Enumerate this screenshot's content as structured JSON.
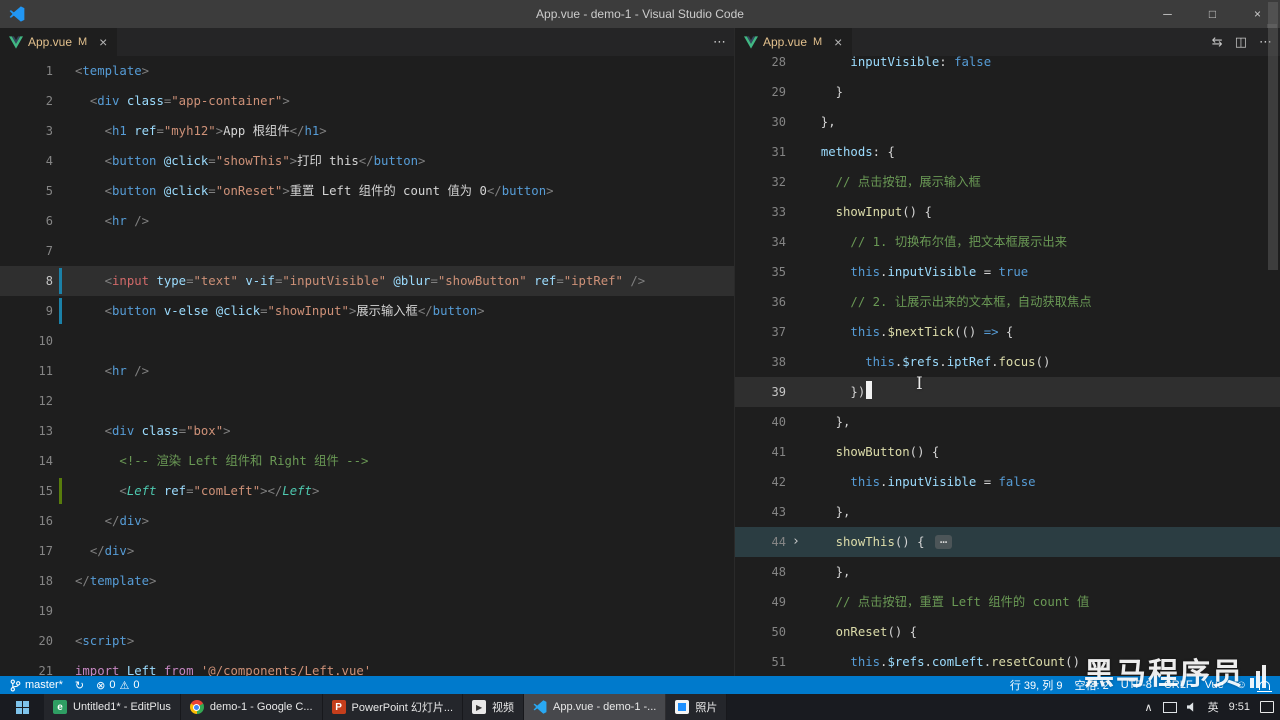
{
  "window": {
    "title": "App.vue - demo-1 - Visual Studio Code"
  },
  "icons": {
    "close": "×",
    "more": "⋯",
    "split": "◫",
    "compare": "⇆",
    "minimize": "─",
    "maximize": "□",
    "chevron_up": "∧",
    "fold_collapsed": "›",
    "sync": "↻",
    "error": "⊗",
    "warning": "⚠",
    "smiley": "☺"
  },
  "colors": {
    "accent": "#007acc",
    "editor_bg": "#1e1e1e",
    "tab_modified_text": "#e2c08d",
    "git_added": "#587c0c",
    "git_modified": "#1b81a8"
  },
  "panes": [
    {
      "tab": {
        "label": "App.vue",
        "badge": "M"
      },
      "actions": [
        "more"
      ],
      "lines": [
        {
          "n": 1,
          "toks": [
            [
              "p",
              "<"
            ],
            [
              "tag",
              "template"
            ],
            [
              "p",
              ">"
            ]
          ]
        },
        {
          "n": 2,
          "toks": [
            [
              "w",
              "  "
            ],
            [
              "p",
              "<"
            ],
            [
              "tag",
              "div"
            ],
            [
              "w",
              " "
            ],
            [
              "attr",
              "class"
            ],
            [
              "p",
              "="
            ],
            [
              "str",
              "\"app-container\""
            ],
            [
              "p",
              ">"
            ]
          ]
        },
        {
          "n": 3,
          "toks": [
            [
              "w",
              "    "
            ],
            [
              "p",
              "<"
            ],
            [
              "tag",
              "h1"
            ],
            [
              "w",
              " "
            ],
            [
              "attr",
              "ref"
            ],
            [
              "p",
              "="
            ],
            [
              "str",
              "\"myh12\""
            ],
            [
              "p",
              ">"
            ],
            [
              "w",
              "App 根组件"
            ],
            [
              "p",
              "</"
            ],
            [
              "tag",
              "h1"
            ],
            [
              "p",
              ">"
            ]
          ]
        },
        {
          "n": 4,
          "toks": [
            [
              "w",
              "    "
            ],
            [
              "p",
              "<"
            ],
            [
              "tag",
              "button"
            ],
            [
              "w",
              " "
            ],
            [
              "attr",
              "@click"
            ],
            [
              "p",
              "="
            ],
            [
              "str",
              "\"showThis\""
            ],
            [
              "p",
              ">"
            ],
            [
              "w",
              "打印 this"
            ],
            [
              "p",
              "</"
            ],
            [
              "tag",
              "button"
            ],
            [
              "p",
              ">"
            ]
          ]
        },
        {
          "n": 5,
          "toks": [
            [
              "w",
              "    "
            ],
            [
              "p",
              "<"
            ],
            [
              "tag",
              "button"
            ],
            [
              "w",
              " "
            ],
            [
              "attr",
              "@click"
            ],
            [
              "p",
              "="
            ],
            [
              "str",
              "\"onReset\""
            ],
            [
              "p",
              ">"
            ],
            [
              "w",
              "重置 Left 组件的 count 值为 0"
            ],
            [
              "p",
              "</"
            ],
            [
              "tag",
              "button"
            ],
            [
              "p",
              ">"
            ]
          ]
        },
        {
          "n": 6,
          "toks": [
            [
              "w",
              "    "
            ],
            [
              "p",
              "<"
            ],
            [
              "tag",
              "hr"
            ],
            [
              "w",
              " "
            ],
            [
              "p",
              "/>"
            ]
          ]
        },
        {
          "n": 7,
          "toks": []
        },
        {
          "n": 8,
          "hl": "cur",
          "git": "mod",
          "toks": [
            [
              "w",
              "    "
            ],
            [
              "p",
              "<"
            ],
            [
              "red",
              "input"
            ],
            [
              "w",
              " "
            ],
            [
              "attr",
              "type"
            ],
            [
              "p",
              "="
            ],
            [
              "str",
              "\"text\""
            ],
            [
              "w",
              " "
            ],
            [
              "attr",
              "v-if"
            ],
            [
              "p",
              "="
            ],
            [
              "str",
              "\"inputVisible\""
            ],
            [
              "w",
              " "
            ],
            [
              "attr",
              "@blur"
            ],
            [
              "p",
              "="
            ],
            [
              "str",
              "\"showButton\""
            ],
            [
              "w",
              " "
            ],
            [
              "attr",
              "ref"
            ],
            [
              "p",
              "="
            ],
            [
              "str",
              "\"iptRef\""
            ],
            [
              "w",
              " "
            ],
            [
              "p",
              "/>"
            ]
          ]
        },
        {
          "n": 9,
          "git": "mod",
          "toks": [
            [
              "w",
              "    "
            ],
            [
              "p",
              "<"
            ],
            [
              "tag",
              "button"
            ],
            [
              "w",
              " "
            ],
            [
              "attr",
              "v-else"
            ],
            [
              "w",
              " "
            ],
            [
              "attr",
              "@click"
            ],
            [
              "p",
              "="
            ],
            [
              "str",
              "\"showInput\""
            ],
            [
              "p",
              ">"
            ],
            [
              "w",
              "展示输入框"
            ],
            [
              "p",
              "</"
            ],
            [
              "tag",
              "button"
            ],
            [
              "p",
              ">"
            ]
          ]
        },
        {
          "n": 10,
          "toks": []
        },
        {
          "n": 11,
          "toks": [
            [
              "w",
              "    "
            ],
            [
              "p",
              "<"
            ],
            [
              "tag",
              "hr"
            ],
            [
              "w",
              " "
            ],
            [
              "p",
              "/>"
            ]
          ]
        },
        {
          "n": 12,
          "toks": []
        },
        {
          "n": 13,
          "toks": [
            [
              "w",
              "    "
            ],
            [
              "p",
              "<"
            ],
            [
              "tag",
              "div"
            ],
            [
              "w",
              " "
            ],
            [
              "attr",
              "class"
            ],
            [
              "p",
              "="
            ],
            [
              "str",
              "\"box\""
            ],
            [
              "p",
              ">"
            ]
          ]
        },
        {
          "n": 14,
          "toks": [
            [
              "w",
              "      "
            ],
            [
              "cmt",
              "<!-- 渲染 Left 组件和 Right 组件 -->"
            ]
          ]
        },
        {
          "n": 15,
          "git": "add",
          "toks": [
            [
              "w",
              "      "
            ],
            [
              "p",
              "<"
            ],
            [
              "comp",
              "Left"
            ],
            [
              "w",
              " "
            ],
            [
              "attr",
              "ref"
            ],
            [
              "p",
              "="
            ],
            [
              "str",
              "\"comLeft\""
            ],
            [
              "p",
              ">"
            ],
            [
              "p",
              "</"
            ],
            [
              "comp",
              "Left"
            ],
            [
              "p",
              ">"
            ]
          ]
        },
        {
          "n": 16,
          "toks": [
            [
              "w",
              "    "
            ],
            [
              "p",
              "</"
            ],
            [
              "tag",
              "div"
            ],
            [
              "p",
              ">"
            ]
          ]
        },
        {
          "n": 17,
          "toks": [
            [
              "w",
              "  "
            ],
            [
              "p",
              "</"
            ],
            [
              "tag",
              "div"
            ],
            [
              "p",
              ">"
            ]
          ]
        },
        {
          "n": 18,
          "toks": [
            [
              "p",
              "</"
            ],
            [
              "tag",
              "template"
            ],
            [
              "p",
              ">"
            ]
          ]
        },
        {
          "n": 19,
          "toks": []
        },
        {
          "n": 20,
          "toks": [
            [
              "p",
              "<"
            ],
            [
              "tag",
              "script"
            ],
            [
              "p",
              ">"
            ]
          ]
        },
        {
          "n": 21,
          "toks": [
            [
              "imp",
              "import"
            ],
            [
              "w",
              " "
            ],
            [
              "attr",
              "Left"
            ],
            [
              "w",
              " "
            ],
            [
              "imp",
              "from"
            ],
            [
              "w",
              " "
            ],
            [
              "str",
              "'@/components/Left.vue'"
            ]
          ]
        }
      ]
    },
    {
      "tab": {
        "label": "App.vue",
        "badge": "M"
      },
      "actions": [
        "compare",
        "split",
        "more"
      ],
      "lines": [
        {
          "n": 28,
          "toks": [
            [
              "w",
              "      "
            ],
            [
              "attr",
              "inputVisible"
            ],
            [
              "w",
              ": "
            ],
            [
              "kw",
              "false"
            ]
          ]
        },
        {
          "n": 29,
          "toks": [
            [
              "w",
              "    }"
            ]
          ]
        },
        {
          "n": 30,
          "toks": [
            [
              "w",
              "  },"
            ]
          ]
        },
        {
          "n": 31,
          "toks": [
            [
              "w",
              "  "
            ],
            [
              "attr",
              "methods"
            ],
            [
              "w",
              ": {"
            ]
          ]
        },
        {
          "n": 32,
          "toks": [
            [
              "w",
              "    "
            ],
            [
              "cmt",
              "// 点击按钮，展示输入框"
            ]
          ]
        },
        {
          "n": 33,
          "toks": [
            [
              "w",
              "    "
            ],
            [
              "fn",
              "showInput"
            ],
            [
              "w",
              "() {"
            ]
          ]
        },
        {
          "n": 34,
          "toks": [
            [
              "w",
              "      "
            ],
            [
              "cmt",
              "// 1. 切换布尔值，把文本框展示出来"
            ]
          ]
        },
        {
          "n": 35,
          "toks": [
            [
              "w",
              "      "
            ],
            [
              "kw",
              "this"
            ],
            [
              "w",
              "."
            ],
            [
              "attr",
              "inputVisible"
            ],
            [
              "w",
              " = "
            ],
            [
              "kw",
              "true"
            ]
          ]
        },
        {
          "n": 36,
          "toks": [
            [
              "w",
              "      "
            ],
            [
              "cmt",
              "// 2. 让展示出来的文本框，自动获取焦点"
            ]
          ]
        },
        {
          "n": 37,
          "toks": [
            [
              "w",
              "      "
            ],
            [
              "kw",
              "this"
            ],
            [
              "w",
              "."
            ],
            [
              "fn",
              "$nextTick"
            ],
            [
              "w",
              "(() "
            ],
            [
              "kw",
              "=>"
            ],
            [
              "w",
              " {"
            ]
          ]
        },
        {
          "n": 38,
          "toks": [
            [
              "w",
              "        "
            ],
            [
              "kw",
              "this"
            ],
            [
              "w",
              "."
            ],
            [
              "attr",
              "$refs"
            ],
            [
              "w",
              "."
            ],
            [
              "attr",
              "iptRef"
            ],
            [
              "w",
              "."
            ],
            [
              "fn",
              "focus"
            ],
            [
              "w",
              "()"
            ]
          ]
        },
        {
          "n": 39,
          "hl": "cur",
          "cursor": true,
          "toks": [
            [
              "w",
              "      })"
            ]
          ]
        },
        {
          "n": 40,
          "toks": [
            [
              "w",
              "    },"
            ]
          ]
        },
        {
          "n": 41,
          "toks": [
            [
              "w",
              "    "
            ],
            [
              "fn",
              "showButton"
            ],
            [
              "w",
              "() {"
            ]
          ]
        },
        {
          "n": 42,
          "toks": [
            [
              "w",
              "      "
            ],
            [
              "kw",
              "this"
            ],
            [
              "w",
              "."
            ],
            [
              "attr",
              "inputVisible"
            ],
            [
              "w",
              " = "
            ],
            [
              "kw",
              "false"
            ]
          ]
        },
        {
          "n": 43,
          "toks": [
            [
              "w",
              "    },"
            ]
          ]
        },
        {
          "n": 44,
          "hl": "fold",
          "foldArrow": true,
          "toks": [
            [
              "w",
              "    "
            ],
            [
              "fn",
              "showThis"
            ],
            [
              "w",
              "() { "
            ],
            [
              "fold",
              "⋯"
            ]
          ]
        },
        {
          "n": 48,
          "toks": [
            [
              "w",
              "    },"
            ]
          ]
        },
        {
          "n": 49,
          "toks": [
            [
              "w",
              "    "
            ],
            [
              "cmt",
              "// 点击按钮，重置 Left 组件的 count 值"
            ]
          ]
        },
        {
          "n": 50,
          "toks": [
            [
              "w",
              "    "
            ],
            [
              "fn",
              "onReset"
            ],
            [
              "w",
              "() {"
            ]
          ]
        },
        {
          "n": 51,
          "toks": [
            [
              "w",
              "      "
            ],
            [
              "kw",
              "this"
            ],
            [
              "w",
              "."
            ],
            [
              "attr",
              "$refs"
            ],
            [
              "w",
              "."
            ],
            [
              "attr",
              "comLeft"
            ],
            [
              "w",
              "."
            ],
            [
              "fn",
              "resetCount"
            ],
            [
              "w",
              "()"
            ]
          ]
        }
      ]
    }
  ],
  "statusbar": {
    "branch_label": "master*",
    "errors": "0",
    "warnings": "0",
    "right_items": [
      "行 39, 列 9",
      "空格: 2",
      "UTF-8",
      "CRLF",
      "Vue"
    ]
  },
  "taskbar": {
    "items": [
      {
        "icon": "editplus",
        "label": "Untitled1* - EditPlus"
      },
      {
        "icon": "chrome",
        "label": "demo-1 - Google C..."
      },
      {
        "icon": "powerpoint",
        "label": "PowerPoint 幻灯片..."
      },
      {
        "icon": "video",
        "label": "视频"
      },
      {
        "icon": "vscode",
        "label": "App.vue - demo-1 -...",
        "active": true
      },
      {
        "icon": "photos",
        "label": "照片"
      }
    ],
    "tray": {
      "input_indicator": "英",
      "time": "9:51"
    }
  },
  "watermark": {
    "text": "黑马程序员"
  }
}
